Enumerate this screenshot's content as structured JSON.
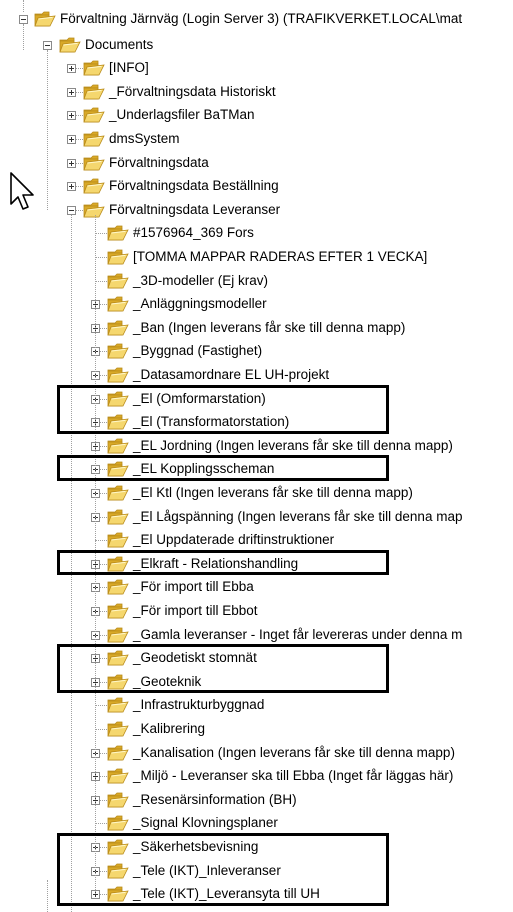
{
  "root": {
    "label": "Förvaltning Järnväg  (Login Server 3) (TRAFIKVERKET.LOCAL\\mat",
    "icon": "locked-folder-icon"
  },
  "documents": {
    "label": "Documents",
    "icon": "folder-icon"
  },
  "level2": [
    {
      "label": "[INFO]",
      "expandable": true
    },
    {
      "label": "_Förvaltningsdata Historiskt",
      "expandable": true
    },
    {
      "label": "_Underlagsfiler BaTMan",
      "expandable": true
    },
    {
      "label": "dmsSystem",
      "expandable": true
    },
    {
      "label": "Förvaltningsdata",
      "expandable": true
    },
    {
      "label": "Förvaltningsdata Beställning",
      "expandable": true
    },
    {
      "label": "Förvaltningsdata Leveranser",
      "expandable": true,
      "expanded": true
    }
  ],
  "level3": [
    {
      "label": "#1576964_369 Fors",
      "expandable": false
    },
    {
      "label": "[TOMMA MAPPAR RADERAS EFTER 1 VECKA]",
      "expandable": false
    },
    {
      "label": "_3D-modeller (Ej krav)",
      "expandable": false
    },
    {
      "label": "_Anläggningsmodeller",
      "expandable": true
    },
    {
      "label": "_Ban (Ingen leverans får ske till denna mapp)",
      "expandable": true
    },
    {
      "label": "_Byggnad (Fastighet)",
      "expandable": true
    },
    {
      "label": "_Datasamordnare EL UH-projekt",
      "expandable": true
    },
    {
      "label": "_El (Omformarstation)",
      "expandable": true
    },
    {
      "label": "_El (Transformatorstation)",
      "expandable": true
    },
    {
      "label": "_EL Jordning (Ingen leverans får ske till denna mapp)",
      "expandable": true
    },
    {
      "label": "_EL Kopplingsscheman",
      "expandable": true
    },
    {
      "label": "_El Ktl (Ingen leverans får ske till denna mapp)",
      "expandable": true
    },
    {
      "label": "_El Lågspänning (Ingen leverans får ske till denna map",
      "expandable": true
    },
    {
      "label": "_El Uppdaterade driftinstruktioner",
      "expandable": false
    },
    {
      "label": "_Elkraft - Relationshandling",
      "expandable": true
    },
    {
      "label": "_För import till Ebba",
      "expandable": true
    },
    {
      "label": "_För import till Ebbot",
      "expandable": true
    },
    {
      "label": "_Gamla leveranser - Inget får levereras under denna m",
      "expandable": true
    },
    {
      "label": "_Geodetiskt stomnät",
      "expandable": true
    },
    {
      "label": "_Geoteknik",
      "expandable": true
    },
    {
      "label": "_Infrastrukturbyggnad",
      "expandable": false
    },
    {
      "label": "_Kalibrering",
      "expandable": false
    },
    {
      "label": "_Kanalisation (Ingen leverans får ske till denna mapp)",
      "expandable": true
    },
    {
      "label": "_Miljö - Leveranser ska till Ebba (Inget får läggas här)",
      "expandable": true
    },
    {
      "label": "_Resenärsinformation (BH)",
      "expandable": true
    },
    {
      "label": "_Signal Klovningsplaner",
      "expandable": false
    },
    {
      "label": "_Säkerhetsbevisning",
      "expandable": true
    },
    {
      "label": "_Tele (IKT)_Inleveranser",
      "expandable": true
    },
    {
      "label": "_Tele (IKT)_Leveransyta till UH",
      "expandable": true
    }
  ],
  "colors": {
    "folder": "#f5d76e",
    "folder_dark": "#d9a927",
    "folder_border": "#b88a1a",
    "line": "#a0a0a0",
    "highlight": "#000000"
  }
}
